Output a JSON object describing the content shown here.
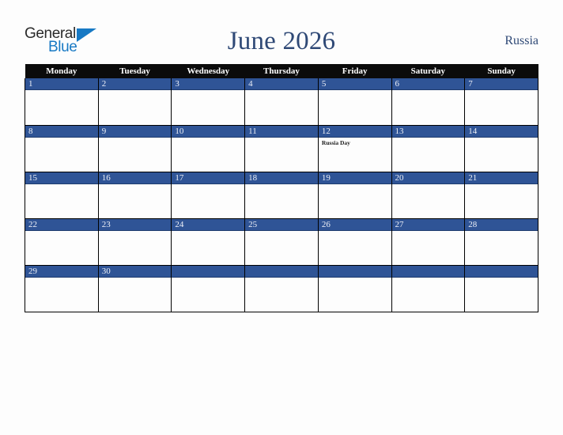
{
  "header": {
    "logo": {
      "word1": "General",
      "word2": "Blue",
      "triangle_color": "#1779c4"
    },
    "title": "June 2026",
    "country": "Russia"
  },
  "calendar": {
    "accent_color": "#2f5496",
    "header_bg": "#0b0b0b",
    "weekday_headers": [
      "Monday",
      "Tuesday",
      "Wednesday",
      "Thursday",
      "Friday",
      "Saturday",
      "Sunday"
    ],
    "weeks": [
      [
        {
          "day": "1",
          "events": []
        },
        {
          "day": "2",
          "events": []
        },
        {
          "day": "3",
          "events": []
        },
        {
          "day": "4",
          "events": []
        },
        {
          "day": "5",
          "events": []
        },
        {
          "day": "6",
          "events": []
        },
        {
          "day": "7",
          "events": []
        }
      ],
      [
        {
          "day": "8",
          "events": []
        },
        {
          "day": "9",
          "events": []
        },
        {
          "day": "10",
          "events": []
        },
        {
          "day": "11",
          "events": []
        },
        {
          "day": "12",
          "events": [
            "Russia Day"
          ]
        },
        {
          "day": "13",
          "events": []
        },
        {
          "day": "14",
          "events": []
        }
      ],
      [
        {
          "day": "15",
          "events": []
        },
        {
          "day": "16",
          "events": []
        },
        {
          "day": "17",
          "events": []
        },
        {
          "day": "18",
          "events": []
        },
        {
          "day": "19",
          "events": []
        },
        {
          "day": "20",
          "events": []
        },
        {
          "day": "21",
          "events": []
        }
      ],
      [
        {
          "day": "22",
          "events": []
        },
        {
          "day": "23",
          "events": []
        },
        {
          "day": "24",
          "events": []
        },
        {
          "day": "25",
          "events": []
        },
        {
          "day": "26",
          "events": []
        },
        {
          "day": "27",
          "events": []
        },
        {
          "day": "28",
          "events": []
        }
      ],
      [
        {
          "day": "29",
          "events": []
        },
        {
          "day": "30",
          "events": []
        },
        {
          "day": "",
          "events": []
        },
        {
          "day": "",
          "events": []
        },
        {
          "day": "",
          "events": []
        },
        {
          "day": "",
          "events": []
        },
        {
          "day": "",
          "events": []
        }
      ]
    ]
  }
}
